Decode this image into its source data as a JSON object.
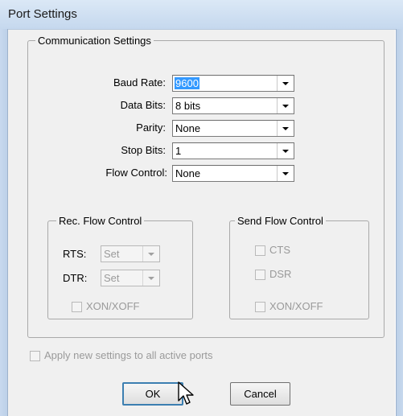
{
  "window": {
    "title": "Port Settings"
  },
  "communication": {
    "legend": "Communication Settings",
    "baud_rate": {
      "label": "Baud Rate:",
      "value": "9600"
    },
    "data_bits": {
      "label": "Data Bits:",
      "value": "8 bits"
    },
    "parity": {
      "label": "Parity:",
      "value": "None"
    },
    "stop_bits": {
      "label": "Stop Bits:",
      "value": "1"
    },
    "flow_control": {
      "label": "Flow Control:",
      "value": "None"
    }
  },
  "rec_flow": {
    "legend": "Rec. Flow Control",
    "rts": {
      "label": "RTS:",
      "value": "Set"
    },
    "dtr": {
      "label": "DTR:",
      "value": "Set"
    },
    "xon_xoff": {
      "label": "XON/XOFF"
    }
  },
  "send_flow": {
    "legend": "Send Flow Control",
    "cts": {
      "label": "CTS"
    },
    "dsr": {
      "label": "DSR"
    },
    "xon_xoff": {
      "label": "XON/XOFF"
    }
  },
  "apply_all": {
    "label": "Apply new settings to all active ports"
  },
  "buttons": {
    "ok": "OK",
    "cancel": "Cancel"
  },
  "colors": {
    "selection": "#3399ff",
    "titlebar": "#c5d8ee",
    "client_bg": "#f0f0f0"
  }
}
